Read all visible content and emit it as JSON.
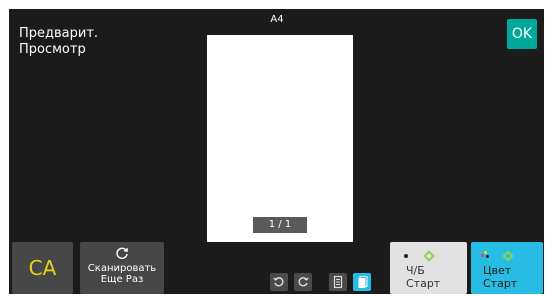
{
  "header": {
    "title_line1": "Предварит.",
    "title_line2": "Просмотр",
    "ok_label": "OK",
    "paper_size": "A4"
  },
  "preview": {
    "page_counter": "1 / 1"
  },
  "footer": {
    "ca_label": "CA",
    "rescan_line1": "Сканировать",
    "rescan_line2": "Еще Раз",
    "bw_start_line1": "Ч/Б",
    "bw_start_line2": "Старт",
    "color_start_line1": "Цвет",
    "color_start_line2": "Старт"
  },
  "colors": {
    "ok_accent": "#00a89b",
    "ca_text": "#e6d21a",
    "color_start_bg": "#27bce3",
    "start_diamond": "#8fd14f"
  }
}
